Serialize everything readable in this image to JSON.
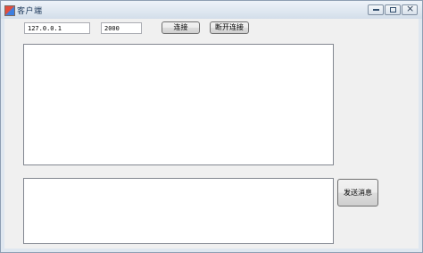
{
  "window": {
    "title": "客户端"
  },
  "controls": {
    "minimize": "minimize",
    "maximize": "maximize",
    "close": "×"
  },
  "connection": {
    "ip_value": "127.0.0.1",
    "port_value": "2000",
    "connect_label": "连接",
    "disconnect_label": "断开连接"
  },
  "message": {
    "send_label": "发送消息"
  }
}
